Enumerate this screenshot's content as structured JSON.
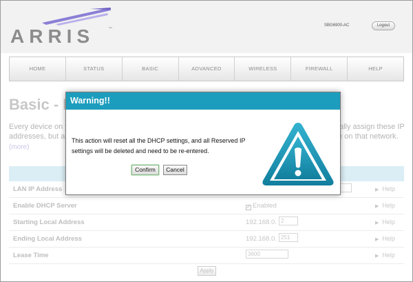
{
  "header": {
    "logo_text": "ARRIS",
    "logo_tm": "™",
    "model": "SBG6900-AC",
    "logout_label": "Logout"
  },
  "nav": {
    "items": [
      {
        "label": "HOME"
      },
      {
        "label": "STATUS"
      },
      {
        "label": "BASIC"
      },
      {
        "label": "ADVANCED"
      },
      {
        "label": "WIRELESS"
      },
      {
        "label": "FIREWALL"
      },
      {
        "label": "HELP"
      }
    ]
  },
  "page": {
    "title": "Basic - D",
    "desc_line1": "Every device on th",
    "desc_line1_right": "ally assign these IP",
    "desc_line2": "addresses, but as",
    "desc_line2_right": "ne on that network.",
    "more": "(more)"
  },
  "rows": [
    {
      "label": "LAN IP Address",
      "help": "Help"
    },
    {
      "label": "Enable DHCP Server",
      "value": "Enabled",
      "checkbox": "✓",
      "help": "Help"
    },
    {
      "label": "Starting Local Address",
      "value": "192.168.0.",
      "input": "2",
      "help": "Help"
    },
    {
      "label": "Ending Local Address",
      "value": "192.168.0.",
      "input": "251",
      "help": "Help"
    },
    {
      "label": "Lease Time",
      "input": "3600",
      "help": "Help"
    }
  ],
  "apply_label": "Apply",
  "modal": {
    "title": "Warning!!",
    "body": "This action will reset all the DHCP settings, and all Reserved IP settings will be deleted and need to be re-entered.",
    "confirm": "Confirm",
    "cancel": "Cancel"
  },
  "colors": {
    "modal_header": "#1d9dbd",
    "warning_icon": "#1a93b3",
    "table_band": "#cfe8f2"
  }
}
